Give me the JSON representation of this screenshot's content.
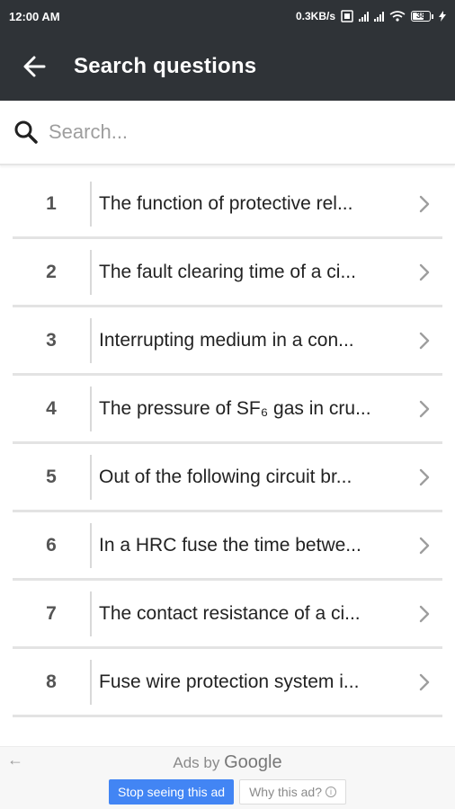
{
  "status_bar": {
    "time": "12:00 AM",
    "net_speed": "0.3KB/s",
    "battery_level": "38"
  },
  "app_bar": {
    "title": "Search questions",
    "back_icon": "arrow-left-icon"
  },
  "search": {
    "placeholder": "Search...",
    "value": "",
    "icon": "search-icon"
  },
  "questions": [
    {
      "number": "1",
      "text": "The function of protective rel..."
    },
    {
      "number": "2",
      "text": "The fault clearing time of a ci..."
    },
    {
      "number": "3",
      "text": "Interrupting medium in a con..."
    },
    {
      "number": "4",
      "text": "The pressure of SF₆ gas in cru..."
    },
    {
      "number": "5",
      "text": "Out of the following circuit br..."
    },
    {
      "number": "6",
      "text": "In a HRC fuse the time betwe..."
    },
    {
      "number": "7",
      "text": "The contact resistance of a ci..."
    },
    {
      "number": "8",
      "text": "Fuse wire protection system i..."
    }
  ],
  "ad": {
    "ads_by": "Ads by",
    "google": "Google",
    "stop_label": "Stop seeing this ad",
    "why_label": "Why this ad?",
    "back_arrow": "←"
  },
  "colors": {
    "app_bar": "#2f3337",
    "accent_blue": "#4285f4",
    "divider": "#e3e3e3"
  }
}
